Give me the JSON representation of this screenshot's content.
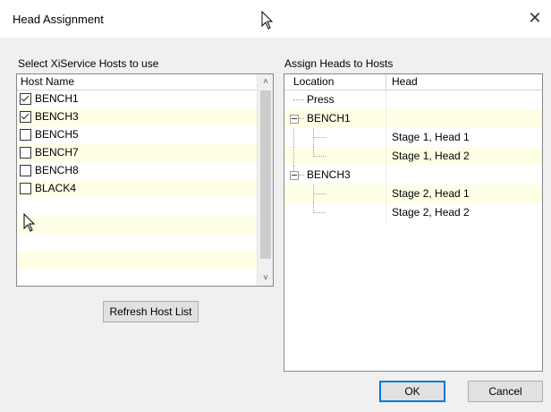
{
  "dialog": {
    "title": "Head Assignment",
    "close_glyph": "✕"
  },
  "hosts_panel": {
    "label": "Select XiService Hosts to use",
    "column_header": "Host Name",
    "hosts": [
      {
        "name": "BENCH1",
        "checked": true
      },
      {
        "name": "BENCH3",
        "checked": true
      },
      {
        "name": "BENCH5",
        "checked": false
      },
      {
        "name": "BENCH7",
        "checked": false
      },
      {
        "name": "BENCH8",
        "checked": false
      },
      {
        "name": "BLACK4",
        "checked": false
      }
    ],
    "refresh_button": "Refresh Host List"
  },
  "heads_panel": {
    "label": "Assign Heads to Hosts",
    "columns": {
      "location": "Location",
      "head": "Head"
    },
    "rows": [
      {
        "location": "Press",
        "head": ""
      },
      {
        "location": "BENCH1",
        "head": ""
      },
      {
        "location": "",
        "head": "Stage 1, Head 1"
      },
      {
        "location": "",
        "head": "Stage 1, Head 2"
      },
      {
        "location": "BENCH3",
        "head": ""
      },
      {
        "location": "",
        "head": "Stage 2, Head 1"
      },
      {
        "location": "",
        "head": "Stage 2, Head 2"
      }
    ]
  },
  "footer": {
    "ok": "OK",
    "cancel": "Cancel"
  },
  "colors": {
    "alt_row": "#ffffe6",
    "default_button_border": "#0078d7"
  }
}
